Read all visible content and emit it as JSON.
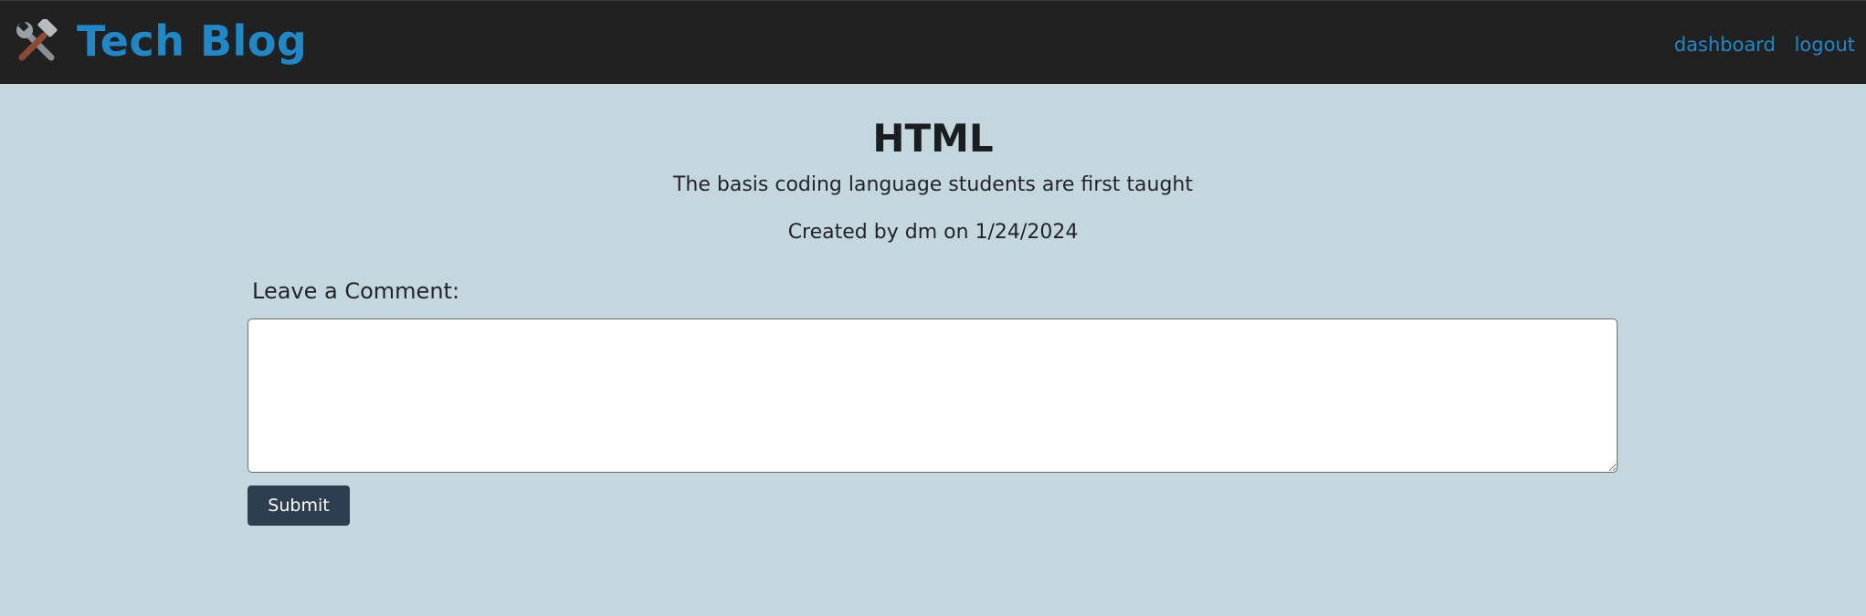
{
  "header": {
    "brand_title": "Tech Blog",
    "brand_icon": "hammer-and-wrench-icon",
    "nav": {
      "dashboard_label": "dashboard",
      "logout_label": "logout"
    }
  },
  "post": {
    "title": "HTML",
    "description": "The basis coding language students are first taught",
    "meta": "Created by dm on 1/24/2024"
  },
  "comment_form": {
    "label": "Leave a Comment:",
    "value": "",
    "submit_label": "Submit"
  },
  "colors": {
    "navbar_bg": "#212121",
    "page_bg": "#c5d7de",
    "link": "#1e88c8",
    "button_bg": "#2c3e50"
  }
}
